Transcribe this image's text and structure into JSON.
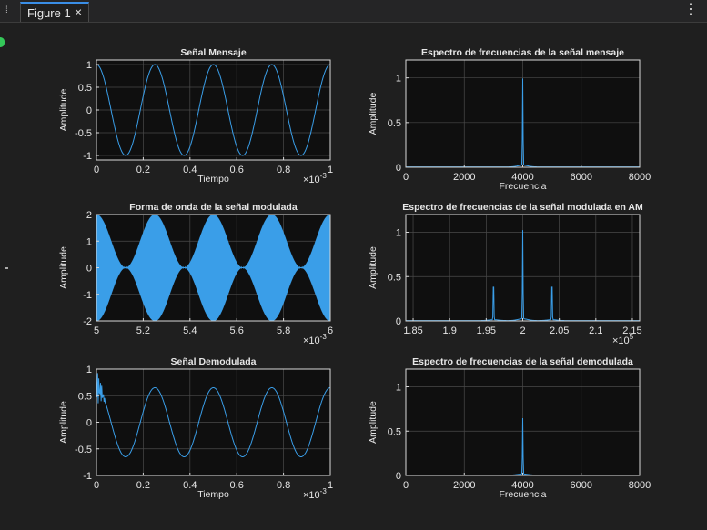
{
  "tab": {
    "label": "Figure 1",
    "close_glyph": "×",
    "menu_glyph": "⋮"
  },
  "chart_data": [
    {
      "type": "line",
      "title": "Señal Mensaje",
      "xlabel": "Tiempo",
      "ylabel": "Amplitude",
      "xlim": [
        0,
        0.001
      ],
      "ylim": [
        -1.1,
        1.1
      ],
      "x_ticks": [
        "0",
        "0.2",
        "0.4",
        "0.6",
        "0.8",
        "1"
      ],
      "y_ticks": [
        "1",
        "0.5",
        "0",
        "-0.5",
        "-1"
      ],
      "x_exponent": "×10",
      "x_exponent_power": "-3",
      "series": [
        {
          "function": "cos",
          "amplitude": 1,
          "frequency_hz": 4000,
          "offset": 0
        }
      ],
      "grid": true
    },
    {
      "type": "line",
      "title": "Espectro de frecuencias de la señal mensaje",
      "xlabel": "Frecuencia",
      "ylabel": "Amplitude",
      "xlim": [
        0,
        8000
      ],
      "ylim": [
        0,
        1.2
      ],
      "x_ticks": [
        "0",
        "2000",
        "4000",
        "6000",
        "8000"
      ],
      "y_ticks": [
        "1",
        "0.5",
        "0"
      ],
      "peaks": [
        {
          "x": 4000,
          "y": 0.97
        }
      ],
      "grid": true
    },
    {
      "type": "line",
      "title": "Forma de onda de la señal modulada",
      "xlabel": "",
      "ylabel": "Amplitude",
      "xlim": [
        0.005,
        0.006
      ],
      "ylim": [
        -2,
        2
      ],
      "x_ticks": [
        "5",
        "5.2",
        "5.4",
        "5.6",
        "5.8",
        "6"
      ],
      "y_ticks": [
        "2",
        "1",
        "0",
        "-1",
        "-2"
      ],
      "x_exponent": "×10",
      "x_exponent_power": "-3",
      "series": [
        {
          "function": "am_envelope",
          "envelope": "1 + cos(2π·4000·t)",
          "carrier_hz": 200000
        }
      ],
      "grid": true
    },
    {
      "type": "line",
      "title": "Espectro de frecuencias de la señal modulada en AM",
      "xlabel": "",
      "ylabel": "Amplitude",
      "xlim": [
        184000,
        216000
      ],
      "ylim": [
        0,
        1.2
      ],
      "x_ticks": [
        "1.85",
        "1.9",
        "1.95",
        "2",
        "2.05",
        "2.1",
        "2.15"
      ],
      "y_ticks": [
        "1",
        "0.5",
        "0"
      ],
      "x_exponent": "×10",
      "x_exponent_power": "5",
      "peaks": [
        {
          "x": 196000,
          "y": 0.5
        },
        {
          "x": 200000,
          "y": 1.0
        },
        {
          "x": 204000,
          "y": 0.5
        }
      ],
      "grid": true
    },
    {
      "type": "line",
      "title": "Señal Demodulada",
      "xlabel": "Tiempo",
      "ylabel": "Amplitude",
      "xlim": [
        0,
        0.001
      ],
      "ylim": [
        -1,
        1
      ],
      "x_ticks": [
        "0",
        "0.2",
        "0.4",
        "0.6",
        "0.8",
        "1"
      ],
      "y_ticks": [
        "1",
        "0.5",
        "0",
        "-0.5",
        "-1"
      ],
      "x_exponent": "×10",
      "x_exponent_power": "-3",
      "series": [
        {
          "function": "cos",
          "amplitude": 0.65,
          "frequency_hz": 4000,
          "offset": 0,
          "transient": true
        }
      ],
      "grid": true
    },
    {
      "type": "line",
      "title": "Espectro de frecuencias de la señal demodulada",
      "xlabel": "Frecuencia",
      "ylabel": "Amplitude",
      "xlim": [
        0,
        8000
      ],
      "ylim": [
        0,
        1.2
      ],
      "x_ticks": [
        "0",
        "2000",
        "4000",
        "6000",
        "8000"
      ],
      "y_ticks": [
        "1",
        "0.5",
        "0"
      ],
      "peaks": [
        {
          "x": 4000,
          "y": 0.63
        }
      ],
      "grid": true
    }
  ],
  "colors": {
    "line": "#3a9ee8",
    "axes_bg": "#0f0f0f",
    "grid": "#4a4a4a",
    "axes_border": "#d8d8d8",
    "text": "#e6e6e6"
  }
}
